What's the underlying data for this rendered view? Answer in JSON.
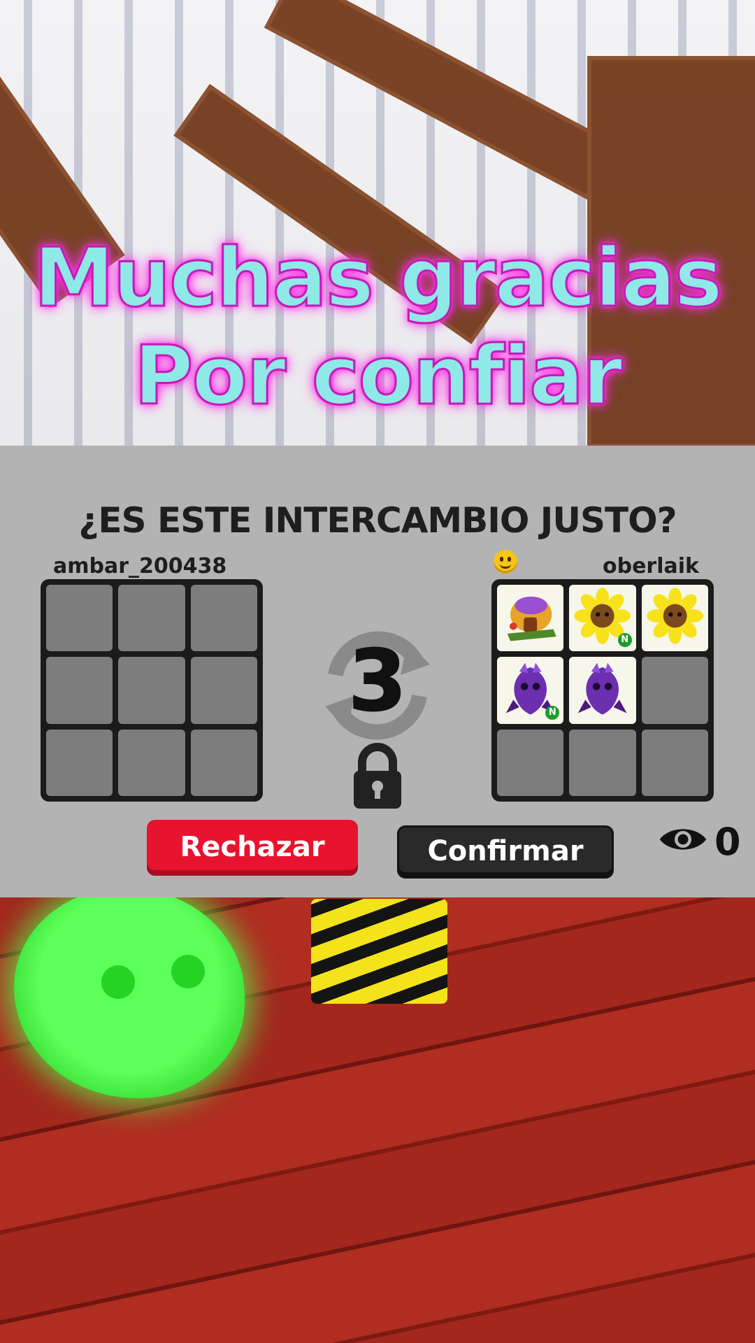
{
  "overlay": {
    "caption_line1": "Muchas gracias",
    "caption_line2": "Por confiar"
  },
  "trade": {
    "title": "¿ES ESTE INTERCAMBIO JUSTO?",
    "left_user": "ambar_200438",
    "right_user": "oberlaik",
    "right_user_icon": "smiley-emoji-icon",
    "countdown": "3",
    "left_items": [],
    "right_items": [
      {
        "name": "pet-house-item",
        "badge": ""
      },
      {
        "name": "sunflower-pet-item",
        "badge": "N"
      },
      {
        "name": "sunflower-pet-item",
        "badge": ""
      },
      {
        "name": "purple-pet-item",
        "badge": "N"
      },
      {
        "name": "purple-pet-item",
        "badge": ""
      }
    ],
    "reject_label": "Rechazar",
    "confirm_label": "Confirmar",
    "viewer_count": "0",
    "colors": {
      "reject": "#e8132f",
      "confirm": "#2a2a2a",
      "caption_text": "#8fe9e6",
      "caption_glow": "#ff2fe8"
    }
  }
}
